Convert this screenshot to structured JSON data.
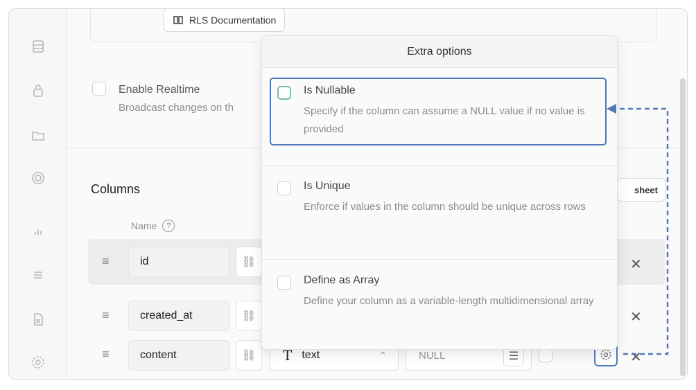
{
  "doc_button": {
    "label": "RLS Documentation",
    "icon": "book-icon"
  },
  "realtime": {
    "title": "Enable Realtime",
    "description": "Broadcast changes on th"
  },
  "columns": {
    "title": "Columns",
    "name_header": "Name",
    "help_icon": "?",
    "sheet_button": "sheet",
    "rows": [
      {
        "name": "id"
      },
      {
        "name": "created_at"
      },
      {
        "name": "content",
        "type": "text",
        "type_icon": "T",
        "default": "NULL"
      }
    ]
  },
  "extra_options": {
    "title": "Extra options",
    "options": [
      {
        "title": "Is Nullable",
        "description": "Specify if the column can assume a NULL value if no value is provided"
      },
      {
        "title": "Is Unique",
        "description": "Enforce if values in the column should be unique across rows"
      },
      {
        "title": "Define as Array",
        "description": "Define your column as a variable-length multidimensional array"
      }
    ]
  },
  "colors": {
    "highlight": "#4e7ab8",
    "checkbox_focus": "#7bbf9a"
  }
}
